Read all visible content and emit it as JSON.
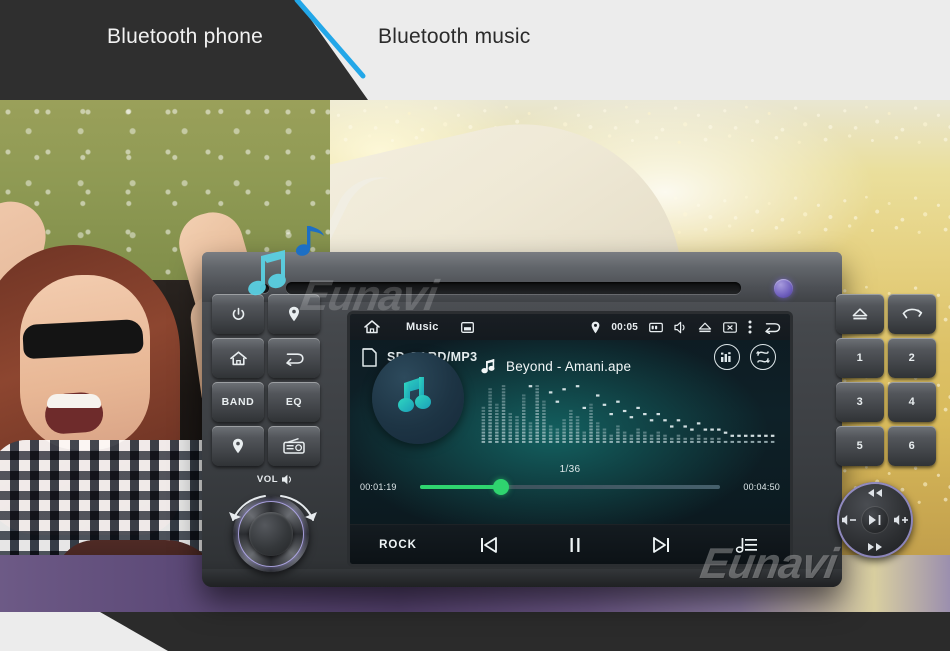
{
  "header": {
    "tabs": [
      {
        "label": "Bluetooth phone",
        "state": "inactive"
      },
      {
        "label": "Bluetooth music",
        "state": "active"
      }
    ],
    "accent_color": "#23a7e8",
    "dark_panel_color": "#2f2f2f",
    "light_panel_color": "#ececec"
  },
  "brand": {
    "watermark": "Eunavi"
  },
  "head_unit": {
    "cd_slot_label": "",
    "reset_hole": "reset",
    "led_color": "#6f5fbe",
    "left_buttons": [
      {
        "label": "",
        "icon": "power-icon",
        "name": "power"
      },
      {
        "label": "",
        "icon": "location-pin-icon",
        "name": "navigation"
      },
      {
        "label": "",
        "icon": "home-icon",
        "name": "home"
      },
      {
        "label": "",
        "icon": "back-arrow-icon",
        "name": "back"
      },
      {
        "label": "BAND",
        "icon": "",
        "name": "band"
      },
      {
        "label": "EQ",
        "icon": "",
        "name": "eq"
      },
      {
        "label": "",
        "icon": "location-pin-icon",
        "name": "gps"
      },
      {
        "label": "",
        "icon": "radio-icon",
        "name": "radio"
      }
    ],
    "right_buttons": [
      {
        "label": "",
        "icon": "eject-icon",
        "name": "eject"
      },
      {
        "label": "",
        "icon": "phone-icon",
        "name": "phone"
      },
      {
        "label": "1",
        "icon": "",
        "name": "preset-1"
      },
      {
        "label": "2",
        "icon": "",
        "name": "preset-2"
      },
      {
        "label": "3",
        "icon": "",
        "name": "preset-3"
      },
      {
        "label": "4",
        "icon": "",
        "name": "preset-4"
      },
      {
        "label": "5",
        "icon": "",
        "name": "preset-5"
      },
      {
        "label": "6",
        "icon": "",
        "name": "preset-6"
      }
    ],
    "volume_knob": {
      "label": "VOL",
      "icon": "speaker-icon"
    },
    "dpad": {
      "up": "prev-track-icon",
      "down": "next-track-icon",
      "left": "volume-down-icon",
      "right": "volume-up-icon",
      "center": "play-pause-icon"
    }
  },
  "screen": {
    "status_bar": {
      "home_icon": "home-icon",
      "app_title": "Music",
      "apps_icon": "apps-icon",
      "gps_icon": "location-pin-icon",
      "clock": "00:05",
      "sd_icon": "sd-card-icon",
      "mute_icon": "speaker-mute-icon",
      "eject_icon": "eject-icon",
      "screenoff_icon": "screen-off-icon",
      "menu_icon": "overflow-menu-icon",
      "back_icon": "back-arrow-icon"
    },
    "source": {
      "icon": "sd-card-icon",
      "label": "SD CARD/MP3",
      "eq_button_icon": "equalizer-icon",
      "repeat_button_icon": "repeat-icon"
    },
    "now_playing": {
      "album_art_icon": "music-note-icon",
      "track_icon": "music-note-icon",
      "track_title": "Beyond - Amani.ape",
      "track_index": "1/36",
      "elapsed": "00:01:19",
      "duration": "00:04:50",
      "progress_percent": 27,
      "progress_color": "#2fd46f"
    },
    "transport": {
      "eq_preset": "ROCK",
      "prev_icon": "skip-previous-icon",
      "pause_icon": "pause-icon",
      "next_icon": "skip-next-icon",
      "playlist_icon": "playlist-icon"
    },
    "spectrum": {
      "bars": [
        12,
        18,
        13,
        22,
        10,
        9,
        16,
        7,
        26,
        14,
        6,
        5,
        8,
        11,
        9,
        4,
        13,
        7,
        5,
        3,
        6,
        4,
        3,
        5,
        4,
        3,
        4,
        3,
        2,
        3,
        2,
        2,
        3,
        2,
        2,
        2,
        1,
        1,
        1,
        1,
        1,
        1,
        1,
        1
      ],
      "peaks": [
        26,
        30,
        27,
        28,
        22,
        20,
        29,
        18,
        31,
        24,
        16,
        13,
        17,
        20,
        18,
        11,
        21,
        15,
        12,
        9,
        13,
        10,
        8,
        11,
        9,
        7,
        9,
        7,
        5,
        7,
        5,
        4,
        6,
        4,
        4,
        4,
        3,
        2,
        2,
        2,
        2,
        2,
        2,
        2
      ]
    }
  },
  "decorations": {
    "note_cyan": "music-note-icon",
    "note_blue": "music-note-icon"
  }
}
